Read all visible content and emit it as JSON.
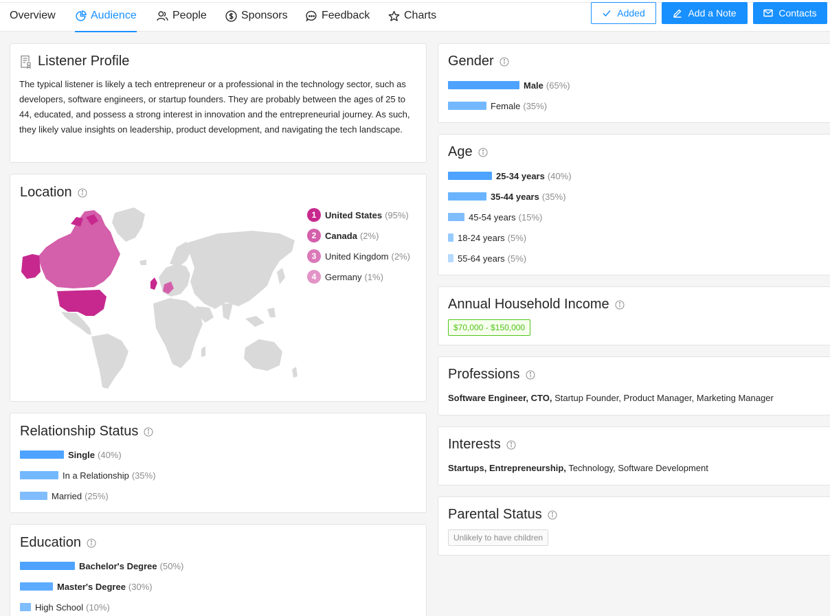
{
  "nav": {
    "tabs": [
      {
        "label": "Overview",
        "icon": "none"
      },
      {
        "label": "Audience",
        "icon": "pie-chart-icon",
        "active": true
      },
      {
        "label": "People",
        "icon": "people-icon"
      },
      {
        "label": "Sponsors",
        "icon": "dollar-icon"
      },
      {
        "label": "Feedback",
        "icon": "chat-icon"
      },
      {
        "label": "Charts",
        "icon": "star-icon"
      }
    ],
    "buttons": {
      "added": "Added",
      "add_note": "Add a Note",
      "contacts": "Contacts"
    }
  },
  "colors": {
    "accent": "#1890ff",
    "bar_primary": "#4da3ff",
    "bar_secondary": "#73b8ff",
    "bar_tertiary": "#96cbff",
    "map_primary": "#c7288e",
    "map_secondary": "#d45fab",
    "map_land": "#d9d9d9",
    "green": "#52c41a"
  },
  "listener_profile": {
    "title": "Listener Profile",
    "text": "The typical listener is likely a tech entrepreneur or a professional in the technology sector, such as developers, software engineers, or startup founders. They are probably between the ages of 25 to 44, educated, and possess a strong interest in innovation and the entrepreneurial journey. As such, they likely value insights on leadership, product development, and navigating the tech landscape."
  },
  "location": {
    "title": "Location",
    "items": [
      {
        "rank": "1",
        "name": "United States",
        "pct": "(95%)"
      },
      {
        "rank": "2",
        "name": "Canada",
        "pct": "(2%)"
      },
      {
        "rank": "3",
        "name": "United Kingdom",
        "pct": "(2%)"
      },
      {
        "rank": "4",
        "name": "Germany",
        "pct": "(1%)"
      }
    ]
  },
  "relationship": {
    "title": "Relationship Status",
    "items": [
      {
        "label": "Single",
        "pct": "(40%)",
        "value": 40
      },
      {
        "label": "In a Relationship",
        "pct": "(35%)",
        "value": 35
      },
      {
        "label": "Married",
        "pct": "(25%)",
        "value": 25
      }
    ]
  },
  "education": {
    "title": "Education",
    "items": [
      {
        "label": "Bachelor's Degree",
        "pct": "(50%)",
        "value": 50
      },
      {
        "label": "Master's Degree",
        "pct": "(30%)",
        "value": 30
      },
      {
        "label": "High School",
        "pct": "(10%)",
        "value": 10
      }
    ]
  },
  "gender": {
    "title": "Gender",
    "items": [
      {
        "label": "Male",
        "pct": "(65%)",
        "value": 65
      },
      {
        "label": "Female",
        "pct": "(35%)",
        "value": 35
      }
    ]
  },
  "age": {
    "title": "Age",
    "items": [
      {
        "label": "25-34 years",
        "pct": "(40%)",
        "value": 40
      },
      {
        "label": "35-44 years",
        "pct": "(35%)",
        "value": 35
      },
      {
        "label": "45-54 years",
        "pct": "(15%)",
        "value": 15
      },
      {
        "label": "18-24 years",
        "pct": "(5%)",
        "value": 5
      },
      {
        "label": "55-64 years",
        "pct": "(5%)",
        "value": 5
      }
    ]
  },
  "income": {
    "title": "Annual Household Income",
    "value": "$70,000 - $150,000"
  },
  "professions": {
    "title": "Professions",
    "bold": "Software Engineer, CTO,",
    "rest": "Startup Founder, Product Manager, Marketing Manager"
  },
  "interests": {
    "title": "Interests",
    "bold": "Startups, Entrepreneurship,",
    "rest": "Technology, Software Development"
  },
  "parental": {
    "title": "Parental Status",
    "value": "Unlikely to have children"
  }
}
